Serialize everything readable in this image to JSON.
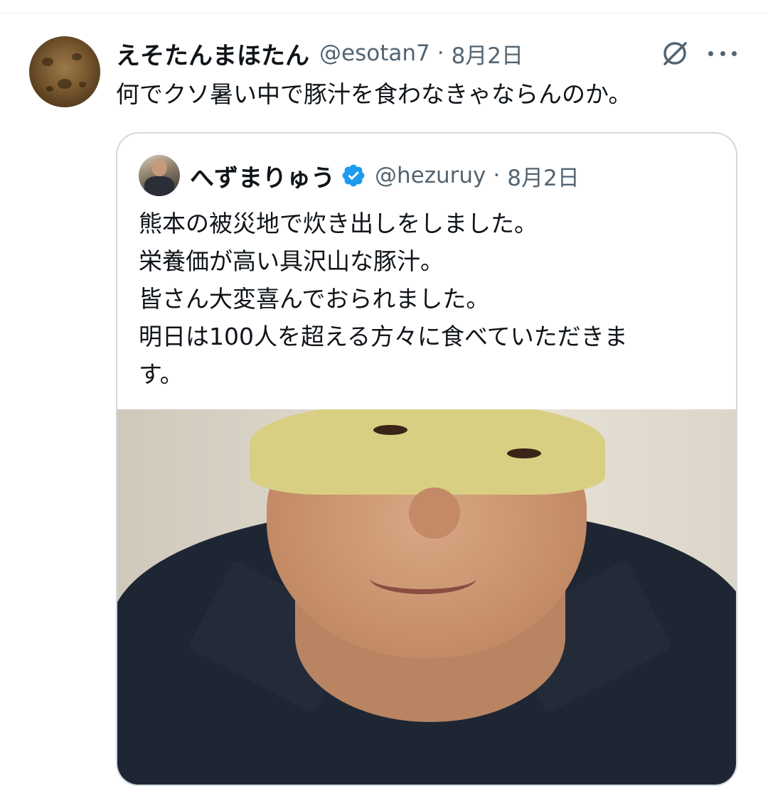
{
  "tweet": {
    "display_name": "えそたんまほたん",
    "handle": "@esotan7",
    "separator": "·",
    "time": "8月2日",
    "text": "何でクソ暑い中で豚汁を食わなきゃならんのか。"
  },
  "quoted_tweet": {
    "display_name": "へずまりゅう",
    "verified": true,
    "handle": "@hezuruy",
    "separator": "·",
    "time": "8月2日",
    "text_lines": [
      "熊本の被災地で炊き出しをしました。",
      "栄養価が高い具沢山な豚汁。",
      "皆さん大変喜んでおられました。",
      "明日は100人を超える方々に食べていただきま",
      "す。"
    ]
  },
  "icons": {
    "grok": "grok-icon",
    "more": "more-options-icon",
    "verified": "verified-badge-icon"
  },
  "colors": {
    "text": "#0f1419",
    "secondary": "#536471",
    "border": "#cfd9de",
    "verified": "#1d9bf0"
  }
}
